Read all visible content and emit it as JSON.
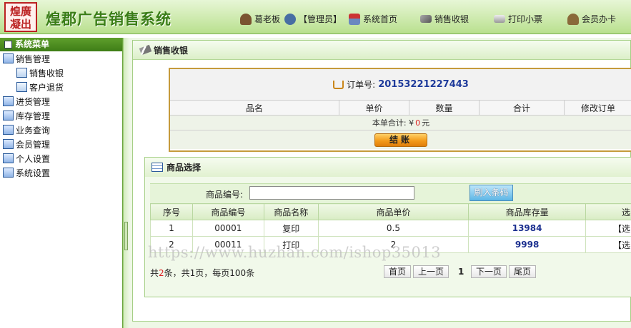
{
  "header": {
    "logo_text": "煌廣凝出",
    "brand": "煌郡广告销售系统",
    "user": "葛老板",
    "role": "【管理员】",
    "nav": [
      {
        "label": "系统首页",
        "icon": "home-icon"
      },
      {
        "label": "销售收银",
        "icon": "sales-icon"
      },
      {
        "label": "打印小票",
        "icon": "print-icon"
      },
      {
        "label": "会员办卡",
        "icon": "member-icon"
      }
    ]
  },
  "sidebar": {
    "title": "系统菜单",
    "items": [
      {
        "label": "销售管理"
      },
      {
        "label": "销售收银"
      },
      {
        "label": "客户退货"
      },
      {
        "label": "进货管理"
      },
      {
        "label": "库存管理"
      },
      {
        "label": "业务查询"
      },
      {
        "label": "会员管理"
      },
      {
        "label": "个人设置"
      },
      {
        "label": "系统设置"
      }
    ]
  },
  "panel": {
    "title": "销售收银"
  },
  "order": {
    "label": "订单号:",
    "number": "20153221227443",
    "columns": [
      "品名",
      "单价",
      "数量",
      "合计",
      "修改订单"
    ],
    "total_prefix": "本单合计: ¥",
    "total_value": "0",
    "total_suffix": "元",
    "pay_button": "结账"
  },
  "goods": {
    "title": "商品选择",
    "search_label": "商品编号:",
    "search_value": "",
    "scan_button": "刷入条码",
    "columns": [
      "序号",
      "商品编号",
      "商品名称",
      "商品单价",
      "商品库存量",
      "选"
    ],
    "rows": [
      {
        "idx": "1",
        "code": "00001",
        "name": "复印",
        "price": "0.5",
        "stock": "13984",
        "action": "【选"
      },
      {
        "idx": "2",
        "code": "00011",
        "name": "打印",
        "price": "2",
        "stock": "9998",
        "action": "【选"
      }
    ]
  },
  "pager": {
    "prefix": "共",
    "count": "2",
    "suffix": "条，共1页，每页100条",
    "first": "首页",
    "prev": "上一页",
    "current": "1",
    "next": "下一页",
    "last": "尾页"
  },
  "watermark": "https://www.huzhan.com/ishop35013",
  "colors": {
    "accent": "#3e7d17",
    "order_border": "#c59a3c",
    "pay_button": "#f39b1b",
    "stock_text": "#1b2f8f"
  }
}
